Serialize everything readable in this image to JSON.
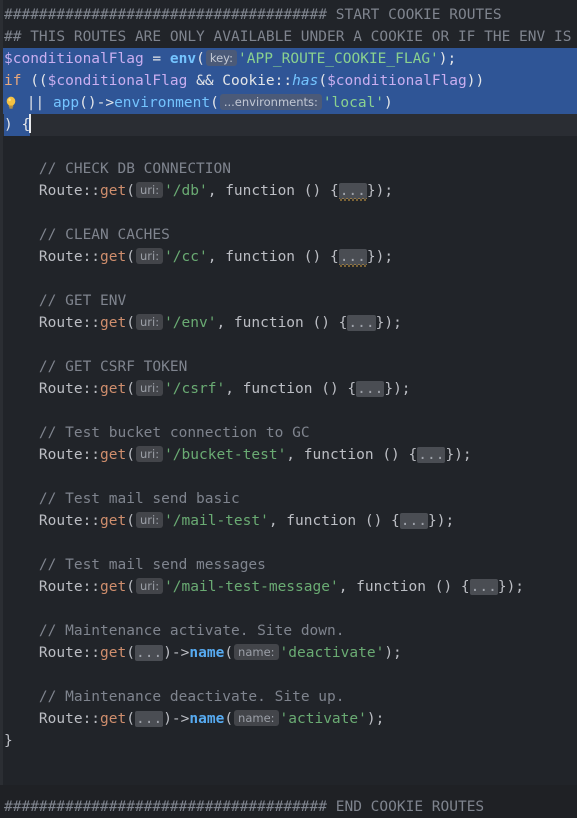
{
  "editor": {
    "language": "php",
    "theme": "darcula",
    "colors": {
      "background": "#212429",
      "selection": "#2f5596",
      "current_line": "#2a2d33",
      "gutter": "#2b2e33",
      "comment": "#7f848e",
      "variable": "#9a84c8",
      "keyword": "#cf8e6d",
      "function": "#57aaf0",
      "string": "#6aab73",
      "plain": "#bcbec4",
      "hint_badge_bg": "#43454a",
      "fold_bg": "#4a4d53",
      "error_squiggle": "#d9a441",
      "caret": "#e8eaed",
      "bulb": "#f5c242"
    }
  },
  "icons": {
    "lightbulb": "lightbulb-icon",
    "caret": "text-caret"
  },
  "code": {
    "banner_start_hashes": "#####################################",
    "banner_start_text": "START COOKIE ROUTES",
    "banner_end_hashes": "#####################################",
    "banner_end_text": "END COOKIE ROUTES",
    "note_comment": "## THIS ROUTES ARE ONLY AVAILABLE UNDER A COOKIE OR IF THE ENV IS LOCAL",
    "condition": {
      "assign_var": "$conditionalFlag",
      "assign_op": " = ",
      "env_fn": "env",
      "env_hint": "key:",
      "env_arg": "'APP_ROUTE_COOKIE_FLAG'",
      "assign_tail": ");",
      "if_keyword": "if",
      "if_open": " ((",
      "if_var1": "$conditionalFlag",
      "if_and": " && ",
      "if_class": "Cookie",
      "if_scope": "::",
      "if_method": "has",
      "if_paren": "(",
      "if_var2": "$conditionalFlag",
      "if_close": "))",
      "or_op": "||",
      "app_fn": "app",
      "app_parens": "()",
      "arrow": "->",
      "environment_fn": "environment",
      "environment_open": "(",
      "environment_hint": "...environments:",
      "environment_arg": "'local'",
      "environment_close": ")",
      "block_open": ") {"
    },
    "routes": [
      {
        "comment": "// CHECK DB CONNECTION",
        "class": "Route",
        "scope": "::",
        "method": "get",
        "hint": "uri:",
        "uri": "'/db'",
        "mid": ", function () {",
        "fold": "...",
        "fold_error": true,
        "tail": "});",
        "name_call": null,
        "name_hint": null,
        "name_value": null
      },
      {
        "comment": "// CLEAN CACHES",
        "class": "Route",
        "scope": "::",
        "method": "get",
        "hint": "uri:",
        "uri": "'/cc'",
        "mid": ", function () {",
        "fold": "...",
        "fold_error": true,
        "tail": "});",
        "name_call": null,
        "name_hint": null,
        "name_value": null
      },
      {
        "comment": "// GET ENV",
        "class": "Route",
        "scope": "::",
        "method": "get",
        "hint": "uri:",
        "uri": "'/env'",
        "mid": ", function () {",
        "fold": "...",
        "fold_error": false,
        "tail": "});",
        "name_call": null,
        "name_hint": null,
        "name_value": null
      },
      {
        "comment": "// GET CSRF TOKEN",
        "class": "Route",
        "scope": "::",
        "method": "get",
        "hint": "uri:",
        "uri": "'/csrf'",
        "mid": ", function () {",
        "fold": "...",
        "fold_error": false,
        "tail": "});",
        "name_call": null,
        "name_hint": null,
        "name_value": null
      },
      {
        "comment": "// Test bucket connection to GC",
        "class": "Route",
        "scope": "::",
        "method": "get",
        "hint": "uri:",
        "uri": "'/bucket-test'",
        "mid": ", function () {",
        "fold": "...",
        "fold_error": false,
        "tail": "});",
        "name_call": null,
        "name_hint": null,
        "name_value": null
      },
      {
        "comment": "// Test mail send basic",
        "class": "Route",
        "scope": "::",
        "method": "get",
        "hint": "uri:",
        "uri": "'/mail-test'",
        "mid": ", function () {",
        "fold": "...",
        "fold_error": false,
        "tail": "});",
        "name_call": null,
        "name_hint": null,
        "name_value": null
      },
      {
        "comment": "// Test mail send messages",
        "class": "Route",
        "scope": "::",
        "method": "get",
        "hint": "uri:",
        "uri": "'/mail-test-message'",
        "mid": ", function () {",
        "fold": "...",
        "fold_error": false,
        "tail": "});",
        "name_call": null,
        "name_hint": null,
        "name_value": null
      },
      {
        "comment": "// Maintenance activate. Site down.",
        "class": "Route",
        "scope": "::",
        "method": "get",
        "hint": null,
        "uri": null,
        "mid": "(",
        "fold": "...",
        "fold_error": false,
        "tail": ")",
        "name_call": "name",
        "name_hint": "name:",
        "name_value": "'deactivate'"
      },
      {
        "comment": "// Maintenance deactivate. Site up.",
        "class": "Route",
        "scope": "::",
        "method": "get",
        "hint": null,
        "uri": null,
        "mid": "(",
        "fold": "...",
        "fold_error": false,
        "tail": ")",
        "name_call": "name",
        "name_hint": "name:",
        "name_value": "'activate'"
      }
    ],
    "block_close": "}"
  }
}
